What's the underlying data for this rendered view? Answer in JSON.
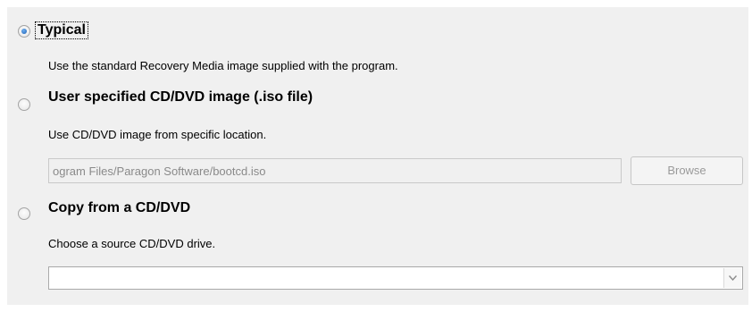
{
  "options": {
    "typical": {
      "label": "Typical",
      "description": "Use the standard Recovery Media image supplied with the program.",
      "selected": true
    },
    "user_image": {
      "label": "User specified CD/DVD image (.iso file)",
      "description": "Use CD/DVD image from specific location.",
      "selected": false,
      "path_value": "ogram Files/Paragon Software/bootcd.iso",
      "browse_label": "Browse"
    },
    "copy_cd": {
      "label": "Copy from a CD/DVD",
      "description": "Choose a source CD/DVD drive.",
      "selected": false,
      "drive_value": ""
    }
  },
  "colors": {
    "panel_bg": "#f0f0f0",
    "radio_selected": "#1c5fb4",
    "disabled_text": "#8a8a8a"
  },
  "icons": {
    "dropdown": "chevron-down-icon"
  }
}
